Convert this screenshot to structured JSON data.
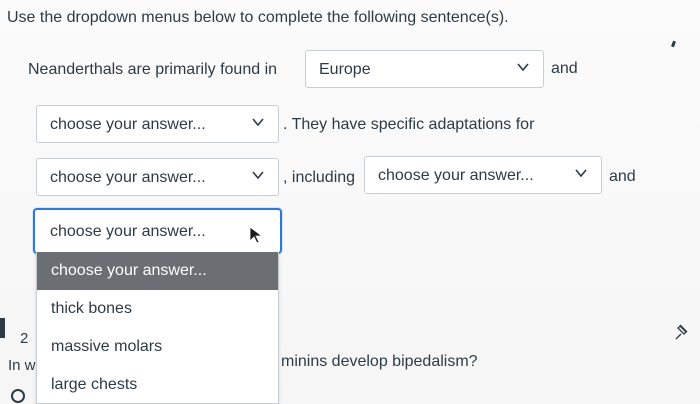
{
  "instruction": "Use the dropdown menus below to complete the following sentence(s).",
  "sentence": {
    "part1": "Neanderthals are primarily found in",
    "select1_value": "Europe",
    "and1": "and",
    "select2_value": "choose your answer...",
    "part2": ". They have specific adaptations for",
    "select3_value": "choose your answer...",
    "part3": ", including",
    "select4_value": "choose your answer...",
    "and2": "and",
    "select5_value": "choose your answer..."
  },
  "dropdown_options": [
    "choose your answer...",
    "thick bones",
    "massive molars",
    "large chests"
  ],
  "next_question": {
    "number_fragment": "2",
    "stem_fragment_left": "In w",
    "stem_fragment_right": "minins develop bipedalism?"
  },
  "icons": {
    "chevron": "chevron-down-icon",
    "cursor": "mouse-pointer-icon",
    "pin": "pin-icon"
  },
  "colors": {
    "text": "#2d3b45",
    "focus_border": "#2d7bd9",
    "highlight_bg": "#6b6f74"
  }
}
